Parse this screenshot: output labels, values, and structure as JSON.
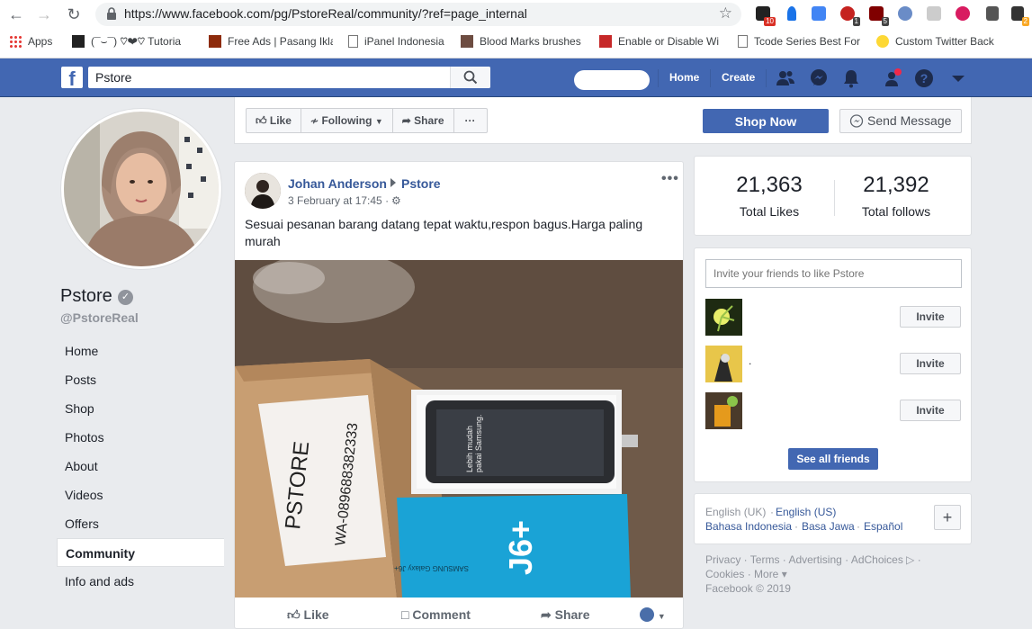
{
  "browser": {
    "url": "https://www.facebook.com/pg/PstoreReal/community/?ref=page_internal",
    "bookmarks": [
      {
        "label": "Apps",
        "icon": "apps-grid-icon"
      },
      {
        "label": "(¯⌣¯) ♡❤♡ Tutoria",
        "icon": "bookmark-site-icon"
      },
      {
        "label": "Free Ads | Pasang Ikla",
        "icon": "bookmark-site-icon"
      },
      {
        "label": "iPanel Indonesia",
        "icon": "page-icon"
      },
      {
        "label": "Blood Marks brushes",
        "icon": "bookmark-site-icon"
      },
      {
        "label": "Enable or Disable Wi",
        "icon": "bookmark-site-icon"
      },
      {
        "label": "Tcode Series Best For",
        "icon": "page-icon"
      },
      {
        "label": "Custom Twitter Back",
        "icon": "smiley-icon"
      }
    ],
    "ext_badges": [
      "10",
      "1",
      "5",
      "2"
    ]
  },
  "fbbar": {
    "search_value": "Pstore",
    "home": "Home",
    "create": "Create"
  },
  "page": {
    "name": "Pstore",
    "handle": "@PstoreReal"
  },
  "leftnav": [
    {
      "label": "Home"
    },
    {
      "label": "Posts"
    },
    {
      "label": "Shop"
    },
    {
      "label": "Photos"
    },
    {
      "label": "About"
    },
    {
      "label": "Videos"
    },
    {
      "label": "Offers"
    },
    {
      "label": "Community",
      "active": true
    },
    {
      "label": "Info and ads"
    }
  ],
  "actionbar": {
    "like": "Like",
    "following": "Following",
    "share": "Share",
    "more": "···",
    "shop_now": "Shop Now",
    "send_message": "Send Message"
  },
  "post": {
    "author": "Johan Anderson",
    "target": "Pstore",
    "time": "3 February at 17:45 ·",
    "text": "Sesuai pesanan barang datang tepat waktu,respon bagus.Harga paling murah",
    "photo_note_1": "PSTORE",
    "photo_note_2": "WA-089688382333",
    "photo_box_text_1": "Lebih mudah",
    "photo_box_text_2": "pakai Samsung.",
    "photo_product": "J6+",
    "photo_brand": "SAMSUNG Galaxy J6+",
    "like": "Like",
    "comment": "Comment",
    "share": "Share"
  },
  "stats": {
    "likes_num": "21,363",
    "likes_lbl": "Total Likes",
    "follows_num": "21,392",
    "follows_lbl": "Total follows"
  },
  "invite": {
    "placeholder": "Invite your friends to like Pstore",
    "friends": [
      {
        "name": "",
        "button": "Invite"
      },
      {
        "name": ".",
        "button": "Invite"
      },
      {
        "name": "",
        "button": "Invite"
      }
    ],
    "see_all": "See all friends"
  },
  "languages": {
    "current": "English (UK)",
    "items": [
      "English (US)",
      "Bahasa Indonesia",
      "Basa Jawa",
      "Español"
    ],
    "plus": "+"
  },
  "footer": {
    "links_line1": "Privacy · Terms · Advertising · AdChoices ▷ ·",
    "links_line2": "Cookies · More ▾",
    "copyright": "Facebook © 2019"
  },
  "colors": {
    "fb_blue": "#4267b2",
    "link_blue": "#365899",
    "bg": "#e9ebee"
  }
}
